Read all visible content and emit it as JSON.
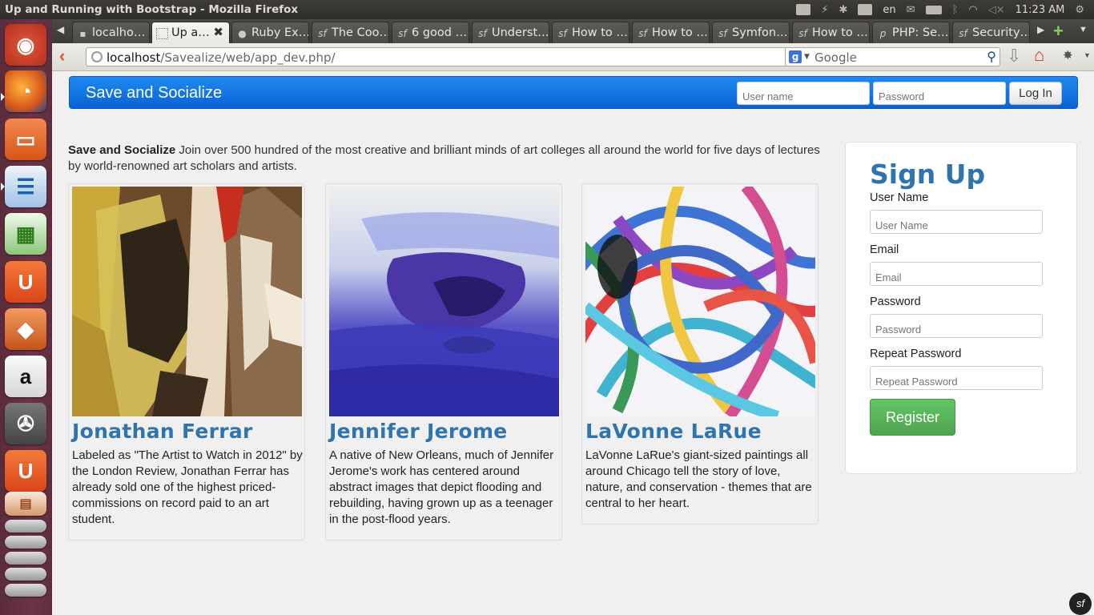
{
  "window": {
    "title": "Up and Running with Bootstrap - Mozilla Firefox"
  },
  "tray": {
    "keyboard_layout": "en",
    "clock": "11:23 AM"
  },
  "tabs": [
    {
      "label": "localho…",
      "active": false,
      "icon": "pma-icon"
    },
    {
      "label": "Up a…",
      "active": true,
      "icon": "page-icon"
    },
    {
      "label": "Ruby Ex…",
      "active": false,
      "icon": "github-icon"
    },
    {
      "label": "The Coo…",
      "active": false,
      "icon": "symfony-icon"
    },
    {
      "label": "6 good …",
      "active": false,
      "icon": "symfony-icon"
    },
    {
      "label": "Underst…",
      "active": false,
      "icon": "symfony-icon"
    },
    {
      "label": "How to …",
      "active": false,
      "icon": "symfony-icon"
    },
    {
      "label": "How to …",
      "active": false,
      "icon": "symfony-icon"
    },
    {
      "label": "Symfon…",
      "active": false,
      "icon": "symfony-icon"
    },
    {
      "label": "How to …",
      "active": false,
      "icon": "symfony-icon"
    },
    {
      "label": "PHP: Se…",
      "active": false,
      "icon": "php-icon"
    },
    {
      "label": "Security…",
      "active": false,
      "icon": "symfony-icon"
    }
  ],
  "address_bar": {
    "host": "localhost",
    "path": "/Savealize/web/app_dev.php/"
  },
  "search_bar": {
    "placeholder": "Google"
  },
  "navbar": {
    "brand": "Save and Socialize",
    "username_placeholder": "User name",
    "password_placeholder": "Password",
    "login_label": "Log In"
  },
  "intro": {
    "bold": "Save and Socialize",
    "text": " Join over 500 hundred of the most creative and brilliant minds of art colleges all around the world for five days of lectures by world-renowned art scholars and artists."
  },
  "artists": [
    {
      "name": "Jonathan Ferrar",
      "bio": "Labeled as \"The Artist to Watch in 2012\" by the London Review, Jonathan Ferrar has already sold one of the highest priced-commissions on record paid to an art student."
    },
    {
      "name": "Jennifer Jerome",
      "bio": "A native of New Orleans, much of Jennifer Jerome's work has centered around abstract images that depict flooding and rebuilding, having grown up as a teenager in the post-flood years."
    },
    {
      "name": "LaVonne LaRue",
      "bio": "LaVonne LaRue's giant-sized paintings all around Chicago tell the story of love, nature, and conservation - themes that are central to her heart."
    }
  ],
  "signup": {
    "title": "Sign Up",
    "fields": [
      {
        "label": "User Name",
        "placeholder": "User Name"
      },
      {
        "label": "Email",
        "placeholder": "Email"
      },
      {
        "label": "Password",
        "placeholder": "Password"
      },
      {
        "label": "Repeat Password",
        "placeholder": "Repeat Password"
      }
    ],
    "register_label": "Register"
  },
  "colors": {
    "brand_blue": "#0a62d4",
    "heading_blue": "#2f74ad",
    "register_green": "#51a351",
    "launcher": "#6e3448"
  }
}
